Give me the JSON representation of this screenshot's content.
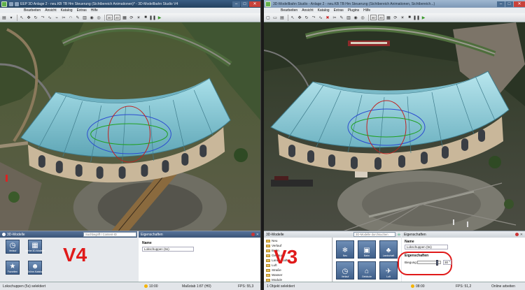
{
  "v4": {
    "title": "EEP 3D Anlage 2 - neu.KB TB Hm Steuerung (Sichtbereich Animationen)* - 3D-Modellbahn Studio V4",
    "menu": [
      "Bearbeiten",
      "Ansicht",
      "Katalog",
      "Extras",
      "Hilfe"
    ],
    "toolbar_mode_3d": "3D",
    "toolbar_mode_2d": "2D",
    "models_panel_title": "3D-Modelle",
    "search_placeholder": "Suchbegriff / Content-ID",
    "props_panel_title": "Eigenschaften",
    "tiles": [
      {
        "label": "Verlauf",
        "icon": "clock-icon"
      },
      {
        "label": "Meine 3D-Modelle",
        "icon": "grid-icon"
      },
      {
        "label": "Favoriten",
        "icon": "star-icon"
      },
      {
        "label": "Online-Katalog",
        "icon": "people-icon"
      }
    ],
    "version_label": "V4",
    "name_label": "Name",
    "name_value": "Lokschuppen (5s)",
    "status_selected": "Lokschuppen (5s) selektiert",
    "status_time": "10:00",
    "status_scale": "Maßstab 1:87 (H0)",
    "status_fps": "FPS: 55,3"
  },
  "v3": {
    "title": "3D-Modellbahn Studio - Anlage 2 - neu.KB TB Hm Steuerung (Sichtbereich Animationen, Sichtbereich...)",
    "menu": [
      "Bearbeiten",
      "Ansicht",
      "Katalog",
      "Extras",
      "Plugins",
      "Hilfe"
    ],
    "toolbar_mode_3d": "3D",
    "toolbar_mode_2d": "2D",
    "models_panel_title": "3D-Modelle",
    "search_placeholder": "3D-Modelle durchsuchen",
    "props_panel_title": "Eigenschaften",
    "tree": [
      "Neu",
      "Verlauf",
      "Bahn",
      "Gebäude",
      "Landschaft",
      "Luft",
      "Straße",
      "Wasser",
      "Module"
    ],
    "tiles": [
      {
        "label": "Neu",
        "icon": "snowflake-icon"
      },
      {
        "label": "Bahn",
        "icon": "train-icon"
      },
      {
        "label": "Landschaft",
        "icon": "tree-icon"
      },
      {
        "label": "Verlauf",
        "icon": "clock-icon"
      },
      {
        "label": "Gebäude",
        "icon": "house-icon"
      },
      {
        "label": "Luft",
        "icon": "plane-icon"
      }
    ],
    "version_label": "V3",
    "name_label": "Name",
    "name_value": "Lokschuppen (5s)",
    "section_label": "Eigenschaften",
    "bend_label": "Biegung:",
    "bend_value": "30 °",
    "bend_level_deg": 30,
    "status_selected": "1 Objekt selektiert",
    "status_time": "08:00",
    "status_fps": "FPS: 51,2",
    "status_online": "Online arbeiten"
  },
  "colors": {
    "roof": "#8fd0dc",
    "roof_dark": "#5fa6b6",
    "wall": "#c9b79a",
    "sky_ground": "#3e4a2e",
    "accent_red": "#e01a1a",
    "panel_blue": "#3b5577"
  }
}
